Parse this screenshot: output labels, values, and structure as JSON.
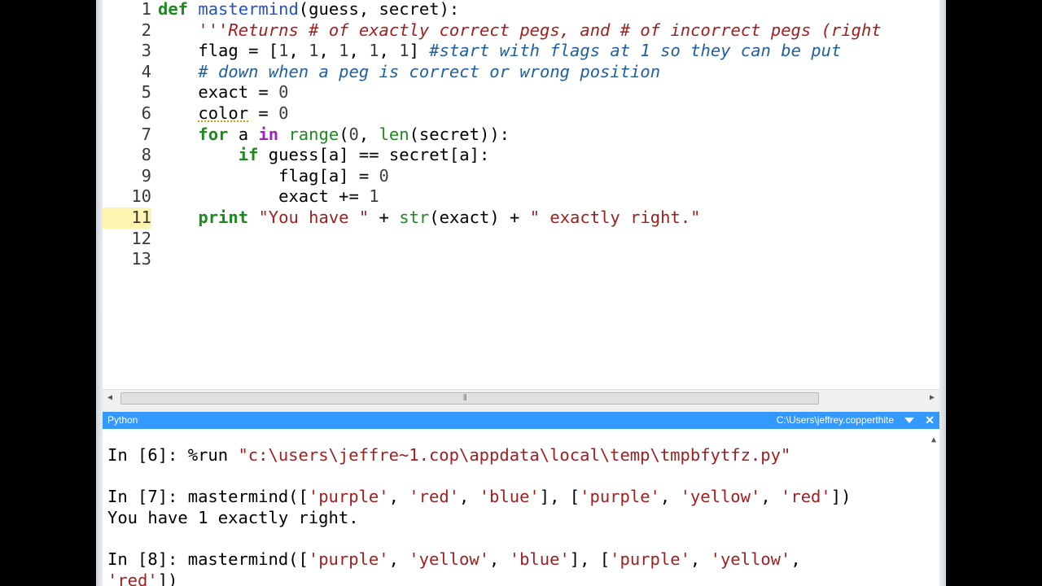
{
  "editor": {
    "lines": [
      {
        "n": "1",
        "tokens": [
          {
            "t": "def ",
            "c": "kw"
          },
          {
            "t": "mastermind",
            "c": "fn"
          },
          {
            "t": "(guess, secret):",
            "c": "op"
          }
        ]
      },
      {
        "n": "2",
        "tokens": [
          {
            "t": "    '''Returns # of exactly correct pegs, and # of incorrect pegs (right",
            "c": "str"
          }
        ]
      },
      {
        "n": "3",
        "tokens": [
          {
            "t": "    flag = [",
            "c": "op"
          },
          {
            "t": "1",
            "c": "num"
          },
          {
            "t": ", ",
            "c": "op"
          },
          {
            "t": "1",
            "c": "num"
          },
          {
            "t": ", ",
            "c": "op"
          },
          {
            "t": "1",
            "c": "num"
          },
          {
            "t": ", ",
            "c": "op"
          },
          {
            "t": "1",
            "c": "num"
          },
          {
            "t": ", ",
            "c": "op"
          },
          {
            "t": "1",
            "c": "num"
          },
          {
            "t": "] ",
            "c": "op"
          },
          {
            "t": "#start with flags at 1 so they can be put",
            "c": "cmt"
          }
        ]
      },
      {
        "n": "4",
        "tokens": [
          {
            "t": "    # down when a peg is correct or wrong position",
            "c": "cmt"
          }
        ]
      },
      {
        "n": "5",
        "tokens": [
          {
            "t": "    exact = ",
            "c": "op"
          },
          {
            "t": "0",
            "c": "num"
          }
        ]
      },
      {
        "n": "6",
        "tokens": [
          {
            "t": "    ",
            "c": "op"
          },
          {
            "t": "color",
            "c": "warn"
          },
          {
            "t": " = ",
            "c": "op"
          },
          {
            "t": "0",
            "c": "num"
          }
        ]
      },
      {
        "n": "7",
        "tokens": [
          {
            "t": "    ",
            "c": "op"
          },
          {
            "t": "for",
            "c": "kw"
          },
          {
            "t": " a ",
            "c": "op"
          },
          {
            "t": "in",
            "c": "kw2"
          },
          {
            "t": " ",
            "c": "op"
          },
          {
            "t": "range",
            "c": "bi"
          },
          {
            "t": "(",
            "c": "op"
          },
          {
            "t": "0",
            "c": "num"
          },
          {
            "t": ", ",
            "c": "op"
          },
          {
            "t": "len",
            "c": "bi"
          },
          {
            "t": "(secret)):",
            "c": "op"
          }
        ]
      },
      {
        "n": "8",
        "tokens": [
          {
            "t": "        ",
            "c": "op"
          },
          {
            "t": "if",
            "c": "kw"
          },
          {
            "t": " guess[a] == secret[a]:",
            "c": "op"
          }
        ]
      },
      {
        "n": "9",
        "tokens": [
          {
            "t": "            flag[a] = ",
            "c": "op"
          },
          {
            "t": "0",
            "c": "num"
          }
        ]
      },
      {
        "n": "10",
        "tokens": [
          {
            "t": "            exact += ",
            "c": "op"
          },
          {
            "t": "1",
            "c": "num"
          }
        ]
      },
      {
        "n": "11",
        "tokens": [
          {
            "t": "    ",
            "c": "op"
          },
          {
            "t": "print",
            "c": "kw"
          },
          {
            "t": " ",
            "c": "op"
          },
          {
            "t": "\"You have \"",
            "c": "str2"
          },
          {
            "t": " + ",
            "c": "op"
          },
          {
            "t": "str",
            "c": "bi"
          },
          {
            "t": "(exact) + ",
            "c": "op"
          },
          {
            "t": "\" exactly right.\"",
            "c": "str2"
          }
        ]
      },
      {
        "n": "12",
        "tokens": []
      },
      {
        "n": "13",
        "tokens": []
      }
    ],
    "current_line": "11"
  },
  "console_pane": {
    "title": "Python",
    "path": "C:\\Users\\jeffrey.copperthite",
    "close_glyph": "✕"
  },
  "console": {
    "lines": [
      {
        "tokens": [
          {
            "t": "In [6]: ",
            "c": "prompt"
          },
          {
            "t": "%run ",
            "c": "op"
          },
          {
            "t": "\"c:\\users\\jeffre~1.cop\\appdata\\local\\temp\\tmpbfytfz.py\"",
            "c": "cstr"
          }
        ]
      },
      {
        "tokens": []
      },
      {
        "tokens": [
          {
            "t": "In [7]: ",
            "c": "prompt"
          },
          {
            "t": "mastermind([",
            "c": "op"
          },
          {
            "t": "'purple'",
            "c": "cstr"
          },
          {
            "t": ", ",
            "c": "op"
          },
          {
            "t": "'red'",
            "c": "cstr"
          },
          {
            "t": ", ",
            "c": "op"
          },
          {
            "t": "'blue'",
            "c": "cstr"
          },
          {
            "t": "], [",
            "c": "op"
          },
          {
            "t": "'purple'",
            "c": "cstr"
          },
          {
            "t": ", ",
            "c": "op"
          },
          {
            "t": "'yellow'",
            "c": "cstr"
          },
          {
            "t": ", ",
            "c": "op"
          },
          {
            "t": "'red'",
            "c": "cstr"
          },
          {
            "t": "])",
            "c": "op"
          }
        ]
      },
      {
        "tokens": [
          {
            "t": "You have 1 exactly right.",
            "c": "op"
          }
        ]
      },
      {
        "tokens": []
      },
      {
        "tokens": [
          {
            "t": "In [8]: ",
            "c": "prompt"
          },
          {
            "t": "mastermind([",
            "c": "op"
          },
          {
            "t": "'purple'",
            "c": "cstr"
          },
          {
            "t": ", ",
            "c": "op"
          },
          {
            "t": "'yellow'",
            "c": "cstr"
          },
          {
            "t": ", ",
            "c": "op"
          },
          {
            "t": "'blue'",
            "c": "cstr"
          },
          {
            "t": "], [",
            "c": "op"
          },
          {
            "t": "'purple'",
            "c": "cstr"
          },
          {
            "t": ", ",
            "c": "op"
          },
          {
            "t": "'yellow'",
            "c": "cstr"
          },
          {
            "t": ",",
            "c": "op"
          }
        ]
      },
      {
        "tokens": [
          {
            "t": "'red'",
            "c": "cstr"
          },
          {
            "t": "])",
            "c": "op"
          }
        ]
      }
    ]
  },
  "colors": {
    "pane_header": "#3399ff",
    "keyword": "#1d8a1d",
    "string": "#a02020",
    "comment": "#2060a0",
    "current_line_gutter": "#fff4b0"
  }
}
